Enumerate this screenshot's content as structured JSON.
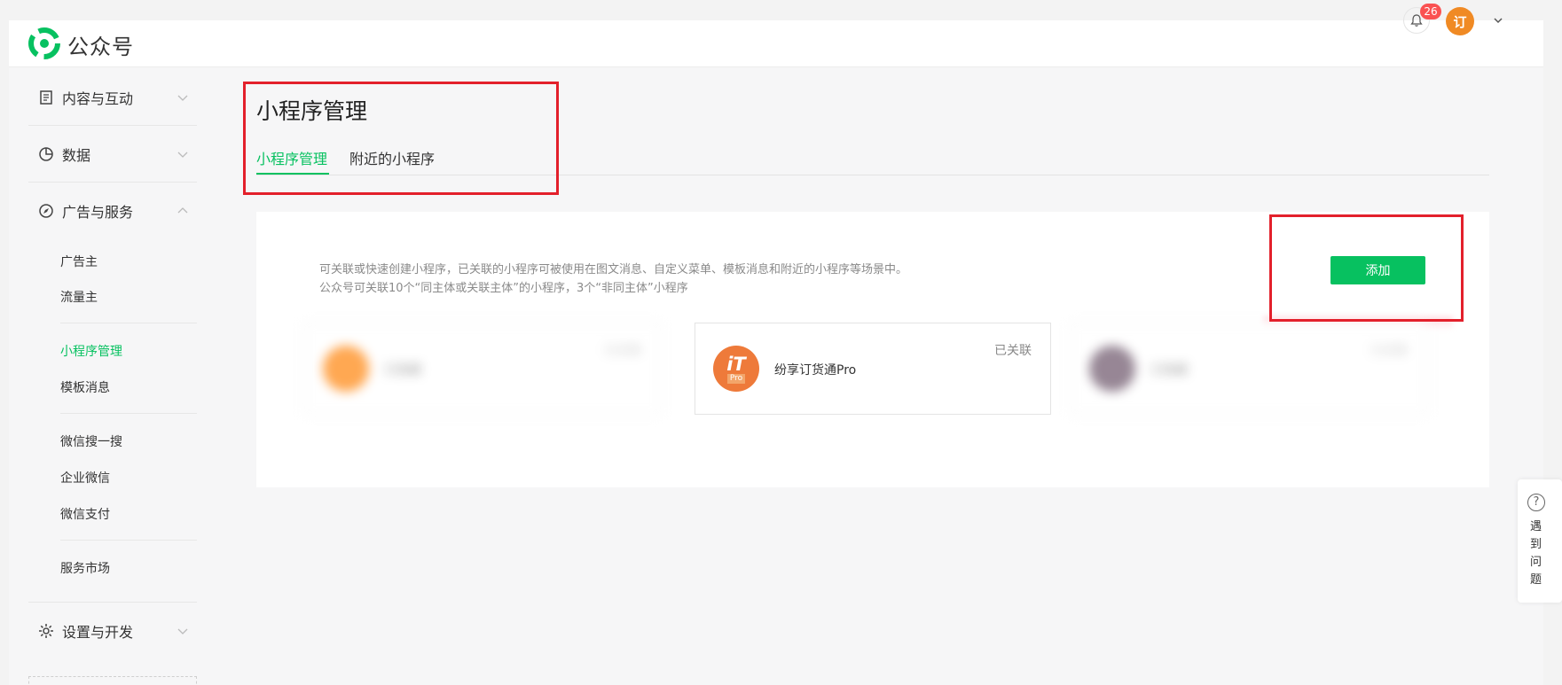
{
  "header": {
    "brand": "公众号",
    "notifications": "26",
    "avatar_text": "订"
  },
  "sidebar": {
    "groups": [
      {
        "label": "内容与互动",
        "icon": "document-icon"
      },
      {
        "label": "数据",
        "icon": "pie-chart-icon"
      },
      {
        "label": "广告与服务",
        "icon": "compass-icon"
      },
      {
        "label": "设置与开发",
        "icon": "gear-icon"
      }
    ],
    "items": [
      "广告主",
      "流量主",
      "小程序管理",
      "模板消息",
      "微信搜一搜",
      "企业微信",
      "微信支付",
      "服务市场"
    ]
  },
  "main": {
    "title": "小程序管理",
    "tabs": [
      "小程序管理",
      "附近的小程序"
    ],
    "description": [
      "可关联或快速创建小程序，已关联的小程序可被使用在图文消息、自定义菜单、模板消息和附近的小程序等场景中。",
      "公众号可关联10个“同主体或关联主体”的小程序，3个“非同主体”小程序"
    ],
    "add_button": "添加",
    "mini_programs": [
      {
        "name": "已隐藏",
        "status": "已关联",
        "blurred": true
      },
      {
        "name": "纷享订货通Pro",
        "status": "已关联",
        "blurred": false,
        "icon_text": "iT",
        "icon_sub": "Pro"
      },
      {
        "name": "已隐藏",
        "status": "已关联",
        "blurred": true
      }
    ]
  },
  "help": {
    "label": "遇到问题"
  },
  "colors": {
    "accent": "#07c160",
    "highlight": "#e3202b",
    "badge": "#fa5151",
    "avatar": "#f08a24"
  }
}
